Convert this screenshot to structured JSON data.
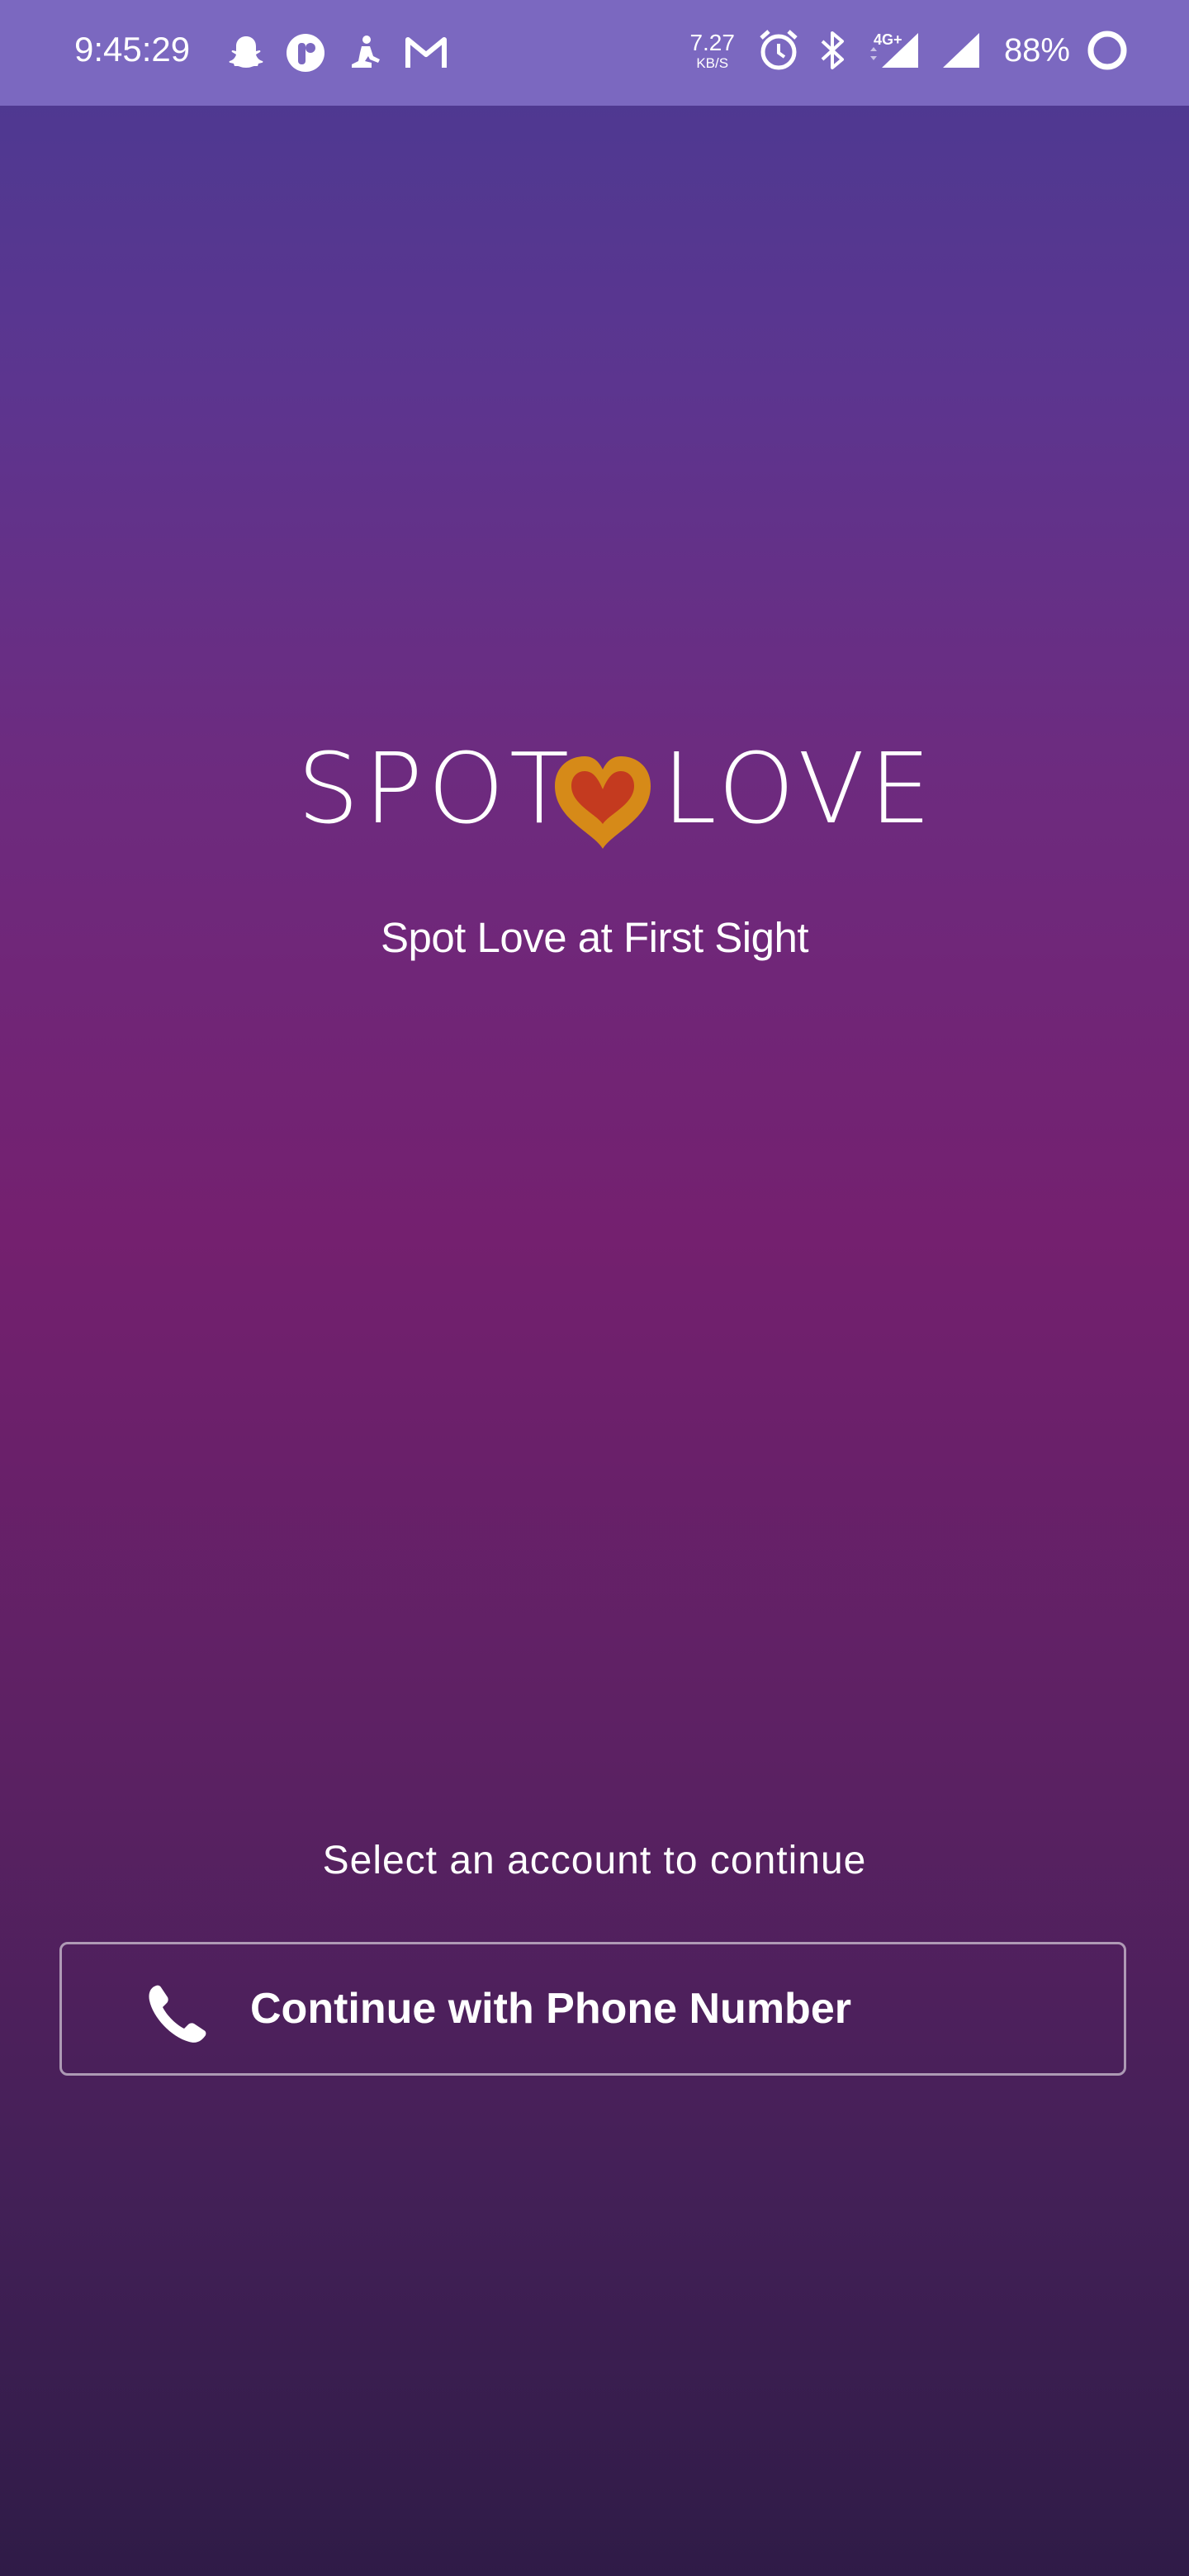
{
  "status_bar": {
    "time": "9:45:29",
    "left_icons": [
      "snapchat-icon",
      "app-icon",
      "meditation-icon",
      "gmail-icon"
    ],
    "net_speed": {
      "value": "7.27",
      "unit": "KB/S"
    },
    "network_label": "4G+",
    "battery": "88%",
    "right_icons": [
      "alarm-icon",
      "bluetooth-icon",
      "signal-icon",
      "signal-icon",
      "battery-ring-icon"
    ]
  },
  "logo": {
    "left_word": "SPOT",
    "right_word": "LOVE",
    "heart_outer_color": "#d68a18",
    "heart_inner_color": "#c43a1f"
  },
  "tagline": "Spot Love at First Sight",
  "account_prompt": "Select an account to continue",
  "continue_button": {
    "label": "Continue with Phone Number",
    "icon": "phone-icon"
  },
  "colors": {
    "status_bar_bg": "#7b68c0",
    "gradient_top": "#4a3a92",
    "gradient_mid": "#74206f",
    "gradient_bottom": "#2f1b47"
  }
}
